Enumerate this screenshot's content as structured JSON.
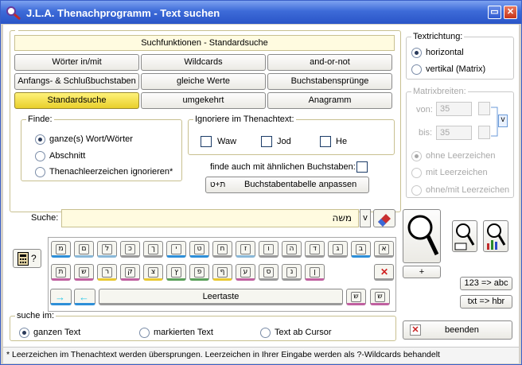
{
  "window": {
    "title": "J.L.A. Thenachprogramm - Text suchen",
    "min_label": "▭",
    "close_label": "✕"
  },
  "search_functions": {
    "header": "Suchfunktionen - Standardsuche",
    "buttons": [
      [
        "Wörter in/mit",
        "Wildcards",
        "and-or-not"
      ],
      [
        "Anfangs- & Schlußbuchstaben",
        "gleiche Werte",
        "Buchstabensprünge"
      ],
      [
        "Standardsuche",
        "umgekehrt",
        "Anagramm"
      ]
    ]
  },
  "finde": {
    "legend": "Finde:",
    "options": [
      "ganze(s) Wort/Wörter",
      "Abschnitt",
      "Thenachleerzeichen ignorieren*"
    ]
  },
  "ignore": {
    "legend": "Ignoriere im Thenachtext:",
    "items": [
      "Waw",
      "Jod",
      "He"
    ]
  },
  "similar": {
    "label": "finde auch mit ähnlichen Buchstaben:"
  },
  "table_button": {
    "icon_text": "ת+ט",
    "label": "Buchstabentabelle anpassen"
  },
  "direction": {
    "legend": "Textrichtung:",
    "options": [
      "horizontal",
      "vertikal (Matrix)"
    ]
  },
  "matrix": {
    "legend": "Matrixbreiten:",
    "von_label": "von:",
    "von_value": "35",
    "bis_label": "bis:",
    "bis_value": "35",
    "link_label": "v",
    "options": [
      "ohne Leerzeichen",
      "mit Leerzeichen",
      "ohne/mit Leerzeichen"
    ]
  },
  "search": {
    "label": "Suche:",
    "value": "משה",
    "v_label": "v"
  },
  "keyboard": {
    "row1": [
      "א",
      "ב",
      "ג",
      "ד",
      "ה",
      "ו",
      "ז",
      "ח",
      "ט",
      "י",
      "ך",
      "כ",
      "ל",
      "ם",
      "מ",
      "ן",
      "נ",
      "ס",
      "ע",
      "ף",
      "פ",
      "ץ"
    ],
    "row2": [
      "צ",
      "ק",
      "ר",
      "ש",
      "ת",
      "⇌",
      "✕"
    ],
    "space_label": "Leertaste",
    "help_label": "?",
    "enter_label": "+",
    "num_label": "123 => abc",
    "txt_label": "txt => hbr"
  },
  "scope": {
    "legend": "suche im:",
    "options": [
      "ganzen Text",
      "markierten Text",
      "Text ab Cursor"
    ]
  },
  "end_button": {
    "label": "beenden"
  },
  "footer": "* Leerzeichen im Thenachtext werden übersprungen. Leerzeichen in Ihrer Eingabe werden als ?-Wildcards behandelt",
  "colors": {
    "title_bar": "#2a55c8",
    "active_button": "#e8cf2c",
    "field_bg": "#fffbe0"
  }
}
